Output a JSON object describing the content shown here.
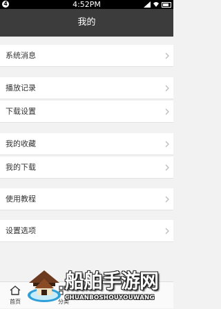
{
  "status_bar": {
    "time": "4:52PM",
    "left_icon_glyph": "4"
  },
  "header": {
    "title": "我的"
  },
  "menu": {
    "groups": [
      {
        "items": [
          {
            "label": "系统消息"
          }
        ]
      },
      {
        "items": [
          {
            "label": "播放记录"
          },
          {
            "label": "下载设置"
          }
        ]
      },
      {
        "items": [
          {
            "label": "我的收藏"
          },
          {
            "label": "我的下载"
          }
        ]
      },
      {
        "items": [
          {
            "label": "使用教程"
          }
        ]
      },
      {
        "items": [
          {
            "label": "设置选项"
          }
        ]
      }
    ]
  },
  "tabbar": {
    "home_label": "首页",
    "second_label": "分类"
  },
  "watermark": {
    "title": "船舶手游网",
    "subtitle": "CHUANBOSHOUYOUWANG"
  },
  "colors": {
    "header_bg": "#3c3c3c",
    "page_bg": "#f2f2f2",
    "row_bg": "#ffffff"
  }
}
